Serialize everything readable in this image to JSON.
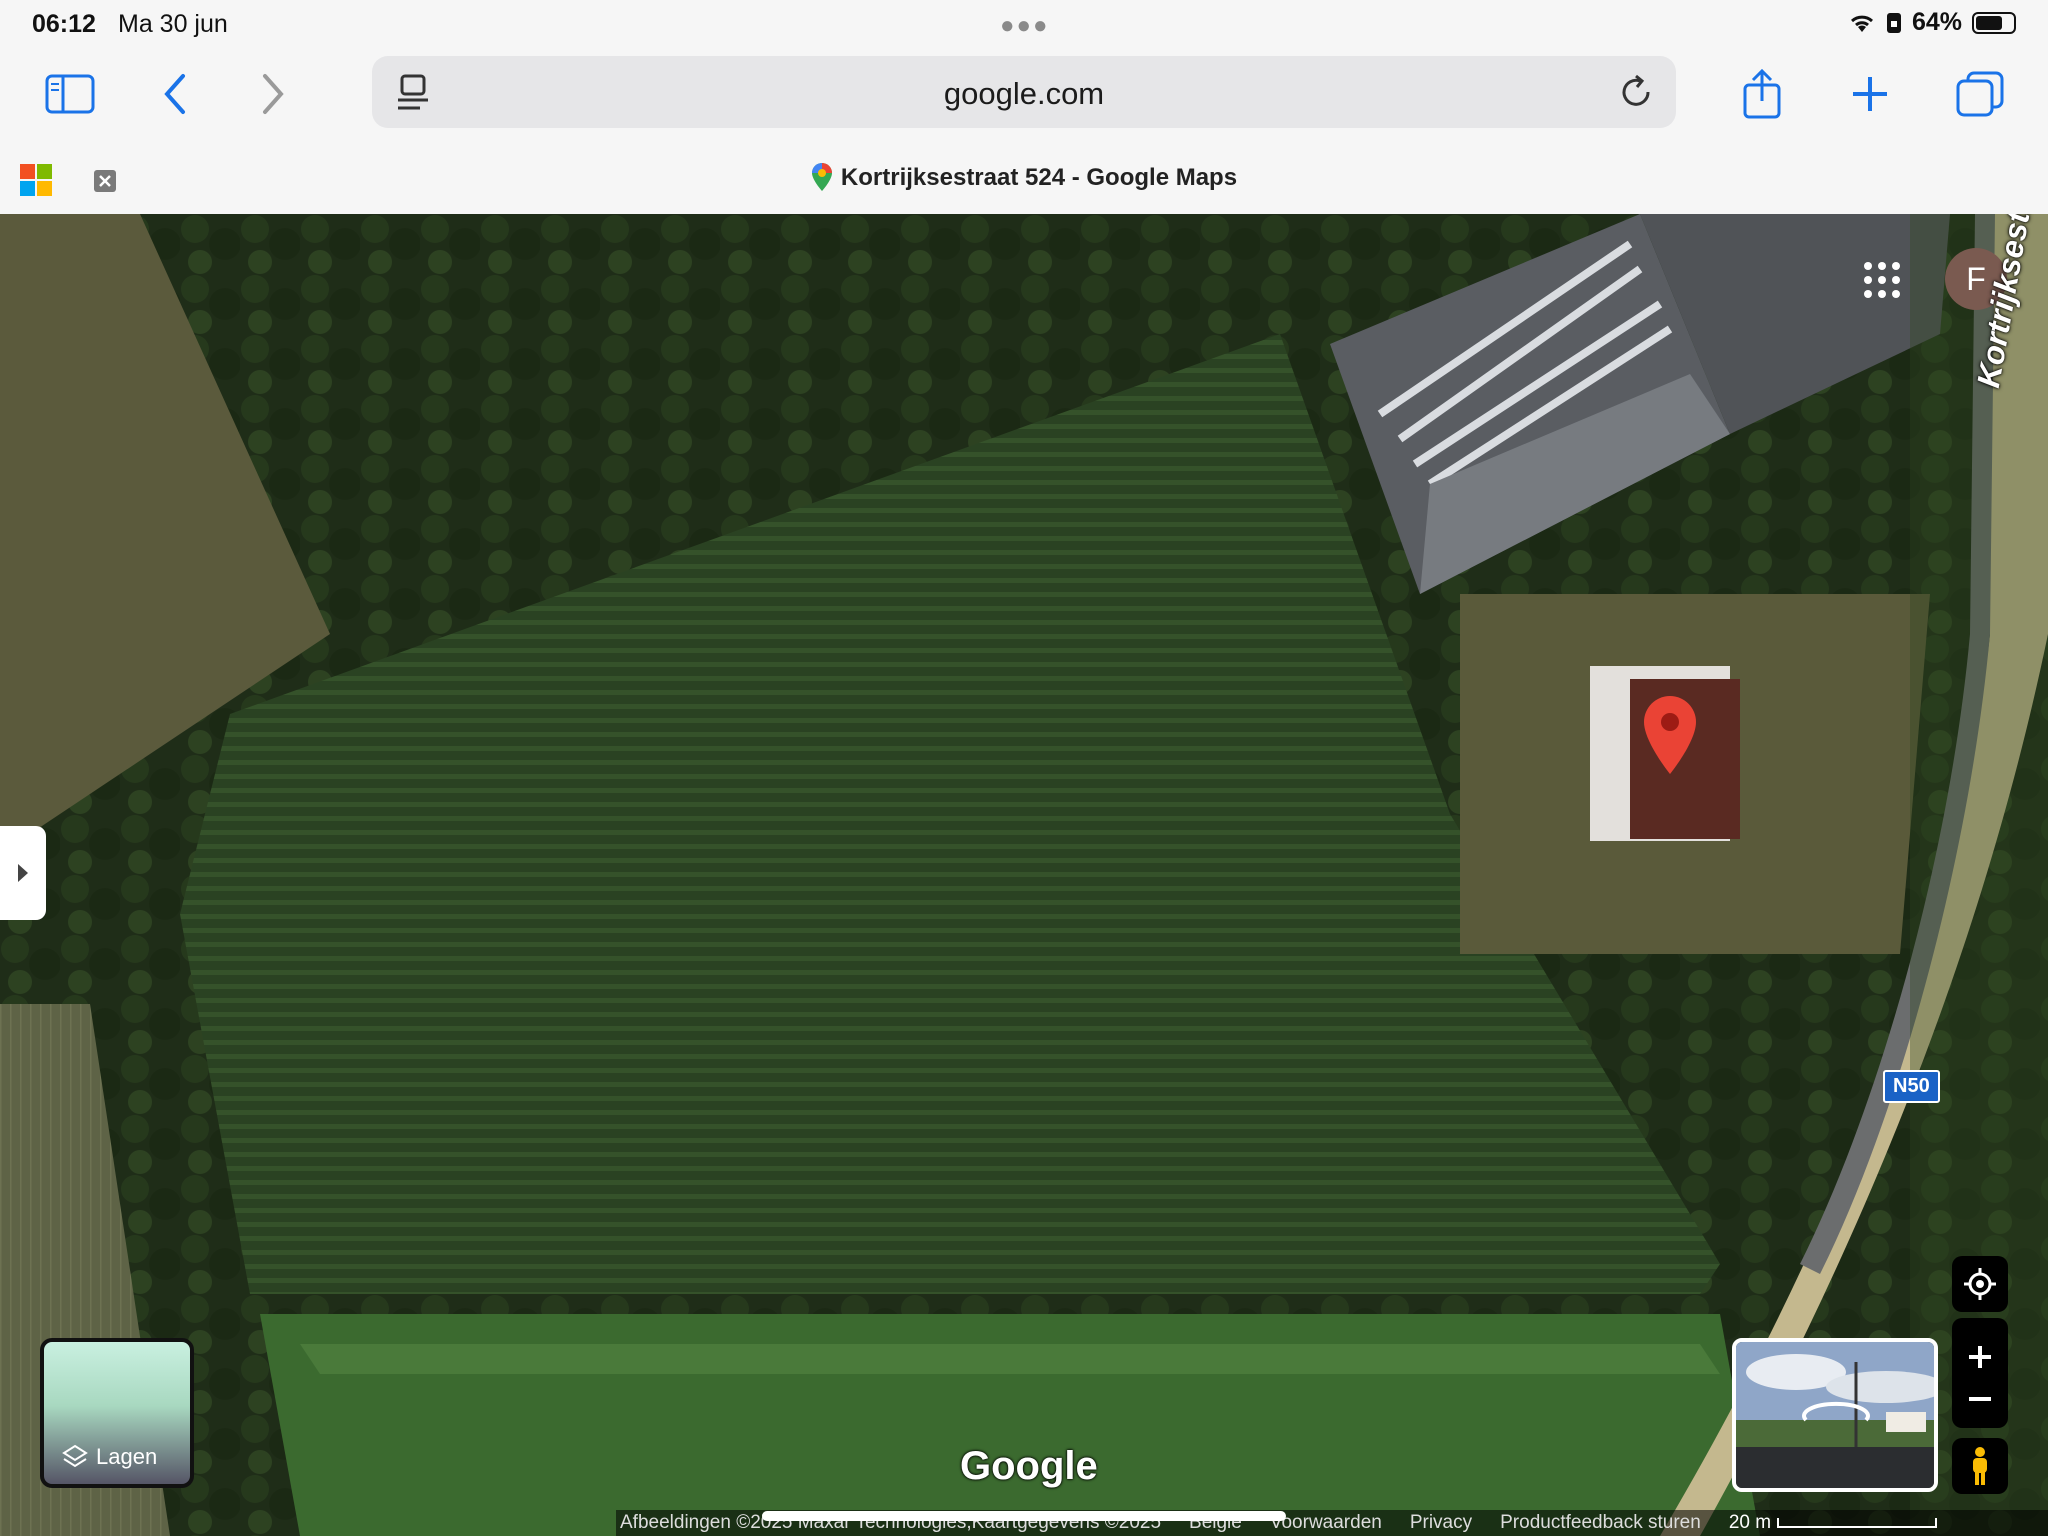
{
  "status": {
    "time": "06:12",
    "date": "Ma 30 jun",
    "battery": "64%",
    "battery_level": 0.64
  },
  "browser": {
    "url": "google.com",
    "tab_title": "Kortrijksestraat 524 - Google Maps"
  },
  "map": {
    "avatar_letter": "F",
    "road_label": "Kortrijksestraat",
    "route_badge": "N50",
    "layers_label": "Lagen",
    "logo": "Google",
    "footer": {
      "imagery": "Afbeeldingen ©2025 Maxar Technologies,Kaartgegevens ©2025",
      "region": "België",
      "terms": "Voorwaarden",
      "privacy": "Privacy",
      "feedback": "Productfeedback sturen",
      "scale": "20 m"
    }
  }
}
